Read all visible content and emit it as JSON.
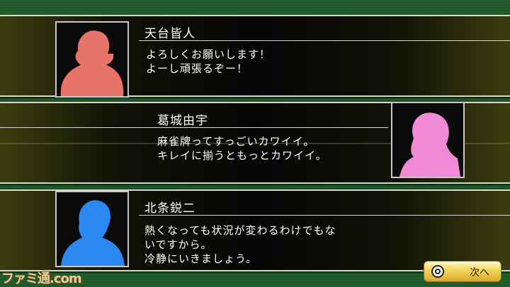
{
  "dialogues": [
    {
      "name": "天台皆人",
      "lines": [
        "よろしくお願いします！",
        "よーし頑張るぞー！"
      ],
      "portrait_color": "#e8736a",
      "portrait_icon": "silhouette-icon"
    },
    {
      "name": "葛城由宇",
      "lines": [
        "麻雀牌ってすっごいカワイイ。",
        "キレイに揃うともっとカワイイ。"
      ],
      "portrait_color": "#f08ad6",
      "portrait_icon": "silhouette-icon"
    },
    {
      "name": "北条鋭二",
      "lines": [
        "熱くなっても状況が変わるわけでもな",
        "いですから。",
        "冷静にいきましょう。"
      ],
      "portrait_color": "#2a88f0",
      "portrait_icon": "silhouette-icon"
    }
  ],
  "next_button": {
    "label": "次へ",
    "icon": "circle-button-icon"
  },
  "watermark": "ファミ通.com"
}
